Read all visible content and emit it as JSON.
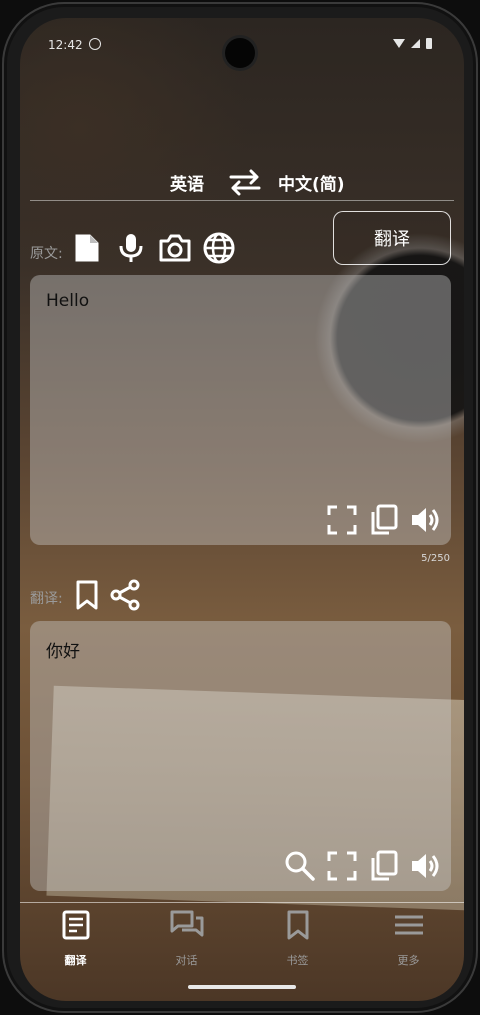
{
  "status_bar": {
    "time": "12:42",
    "icons": [
      "do-not-disturb-icon",
      "wifi-icon",
      "signal-icon",
      "battery-icon"
    ]
  },
  "language_bar": {
    "source_language": "英语",
    "target_language": "中文(简)",
    "swap_icon": "swap-arrows-icon"
  },
  "translate_button": {
    "label": "翻译"
  },
  "source_section": {
    "label": "原文:",
    "tools": [
      "document-icon",
      "microphone-icon",
      "camera-icon",
      "globe-icon"
    ],
    "text": "Hello",
    "actions": [
      "fullscreen-icon",
      "copy-icon",
      "speaker-icon"
    ],
    "counter": "5/250"
  },
  "target_section": {
    "label": "翻译:",
    "tools": [
      "bookmark-icon",
      "share-icon"
    ],
    "text": "你好",
    "actions": [
      "search-icon",
      "fullscreen-icon",
      "copy-icon",
      "speaker-icon"
    ]
  },
  "bottom_nav": {
    "items": [
      {
        "label": "翻译",
        "icon": "translate-doc-icon",
        "active": true
      },
      {
        "label": "对话",
        "icon": "chat-icon",
        "active": false
      },
      {
        "label": "书签",
        "icon": "bookmark-icon",
        "active": false
      },
      {
        "label": "更多",
        "icon": "menu-icon",
        "active": false
      }
    ]
  },
  "colors": {
    "text_primary": "#ffffff",
    "text_muted": "#9a9a9a",
    "card_bg": "rgba(200,200,200,0.42)"
  }
}
